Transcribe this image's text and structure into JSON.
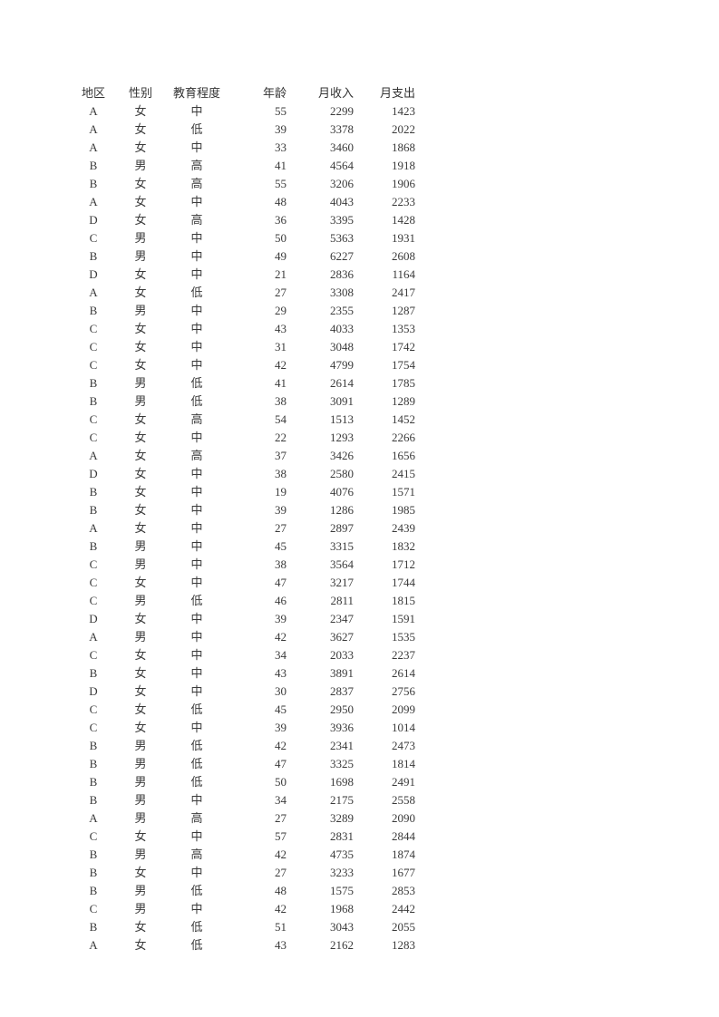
{
  "table": {
    "columns": [
      {
        "key": "region",
        "label": "地区",
        "align": "center"
      },
      {
        "key": "gender",
        "label": "性别",
        "align": "center"
      },
      {
        "key": "edu",
        "label": "教育程度",
        "align": "center"
      },
      {
        "key": "age",
        "label": "年龄",
        "align": "right"
      },
      {
        "key": "income",
        "label": "月收入",
        "align": "right"
      },
      {
        "key": "expense",
        "label": "月支出",
        "align": "right"
      }
    ],
    "rows": [
      [
        "A",
        "女",
        "中",
        "55",
        "2299",
        "1423"
      ],
      [
        "A",
        "女",
        "低",
        "39",
        "3378",
        "2022"
      ],
      [
        "A",
        "女",
        "中",
        "33",
        "3460",
        "1868"
      ],
      [
        "B",
        "男",
        "高",
        "41",
        "4564",
        "1918"
      ],
      [
        "B",
        "女",
        "高",
        "55",
        "3206",
        "1906"
      ],
      [
        "A",
        "女",
        "中",
        "48",
        "4043",
        "2233"
      ],
      [
        "D",
        "女",
        "高",
        "36",
        "3395",
        "1428"
      ],
      [
        "C",
        "男",
        "中",
        "50",
        "5363",
        "1931"
      ],
      [
        "B",
        "男",
        "中",
        "49",
        "6227",
        "2608"
      ],
      [
        "D",
        "女",
        "中",
        "21",
        "2836",
        "1164"
      ],
      [
        "A",
        "女",
        "低",
        "27",
        "3308",
        "2417"
      ],
      [
        "B",
        "男",
        "中",
        "29",
        "2355",
        "1287"
      ],
      [
        "C",
        "女",
        "中",
        "43",
        "4033",
        "1353"
      ],
      [
        "C",
        "女",
        "中",
        "31",
        "3048",
        "1742"
      ],
      [
        "C",
        "女",
        "中",
        "42",
        "4799",
        "1754"
      ],
      [
        "B",
        "男",
        "低",
        "41",
        "2614",
        "1785"
      ],
      [
        "B",
        "男",
        "低",
        "38",
        "3091",
        "1289"
      ],
      [
        "C",
        "女",
        "高",
        "54",
        "1513",
        "1452"
      ],
      [
        "C",
        "女",
        "中",
        "22",
        "1293",
        "2266"
      ],
      [
        "A",
        "女",
        "高",
        "37",
        "3426",
        "1656"
      ],
      [
        "D",
        "女",
        "中",
        "38",
        "2580",
        "2415"
      ],
      [
        "B",
        "女",
        "中",
        "19",
        "4076",
        "1571"
      ],
      [
        "B",
        "女",
        "中",
        "39",
        "1286",
        "1985"
      ],
      [
        "A",
        "女",
        "中",
        "27",
        "2897",
        "2439"
      ],
      [
        "B",
        "男",
        "中",
        "45",
        "3315",
        "1832"
      ],
      [
        "C",
        "男",
        "中",
        "38",
        "3564",
        "1712"
      ],
      [
        "C",
        "女",
        "中",
        "47",
        "3217",
        "1744"
      ],
      [
        "C",
        "男",
        "低",
        "46",
        "2811",
        "1815"
      ],
      [
        "D",
        "女",
        "中",
        "39",
        "2347",
        "1591"
      ],
      [
        "A",
        "男",
        "中",
        "42",
        "3627",
        "1535"
      ],
      [
        "C",
        "女",
        "中",
        "34",
        "2033",
        "2237"
      ],
      [
        "B",
        "女",
        "中",
        "43",
        "3891",
        "2614"
      ],
      [
        "D",
        "女",
        "中",
        "30",
        "2837",
        "2756"
      ],
      [
        "C",
        "女",
        "低",
        "45",
        "2950",
        "2099"
      ],
      [
        "C",
        "女",
        "中",
        "39",
        "3936",
        "1014"
      ],
      [
        "B",
        "男",
        "低",
        "42",
        "2341",
        "2473"
      ],
      [
        "B",
        "男",
        "低",
        "47",
        "3325",
        "1814"
      ],
      [
        "B",
        "男",
        "低",
        "50",
        "1698",
        "2491"
      ],
      [
        "B",
        "男",
        "中",
        "34",
        "2175",
        "2558"
      ],
      [
        "A",
        "男",
        "高",
        "27",
        "3289",
        "2090"
      ],
      [
        "C",
        "女",
        "中",
        "57",
        "2831",
        "2844"
      ],
      [
        "B",
        "男",
        "高",
        "42",
        "4735",
        "1874"
      ],
      [
        "B",
        "女",
        "中",
        "27",
        "3233",
        "1677"
      ],
      [
        "B",
        "男",
        "低",
        "48",
        "1575",
        "2853"
      ],
      [
        "C",
        "男",
        "中",
        "42",
        "1968",
        "2442"
      ],
      [
        "B",
        "女",
        "低",
        "51",
        "3043",
        "2055"
      ],
      [
        "A",
        "女",
        "低",
        "43",
        "2162",
        "1283"
      ]
    ]
  }
}
